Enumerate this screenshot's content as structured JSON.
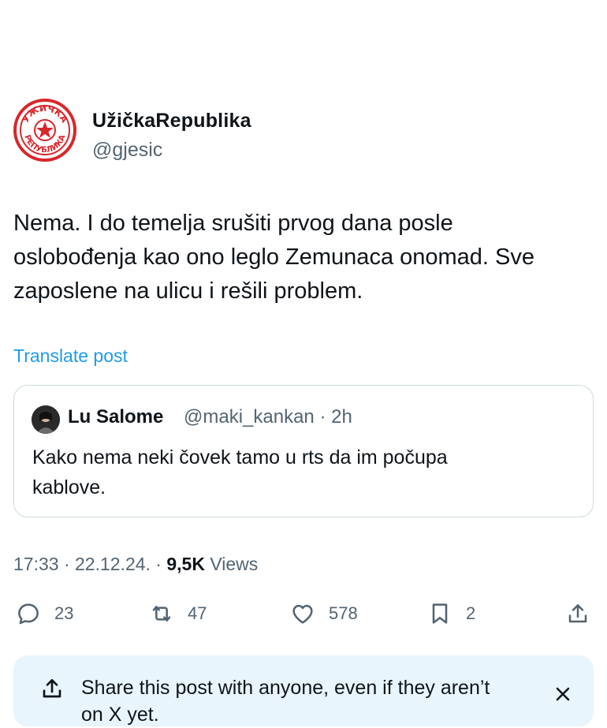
{
  "author": {
    "display_name": "UžičkaRepublika",
    "handle": "@gjesic",
    "avatar_text": "УЖИЧКА РЕПУБЛИКА",
    "avatar_color": "#d9262b"
  },
  "tweet": {
    "lines": [
      "Nema. I do temelja srušiti prvog dana posle",
      "oslobođenja kao ono leglo Zemunaca onomad. Sve",
      "zaposlene na ulicu i rešili problem."
    ],
    "translate_label": "Translate post"
  },
  "quoted": {
    "display_name": "Lu Salome",
    "handle_time": "@maki_kankan · 2h",
    "lines": [
      "Kako nema neki čovek tamo u rts da im počupa",
      "kablove."
    ]
  },
  "meta": {
    "time_date": "17:33 · 22.12.24. · ",
    "views_count": "9,5K",
    "views_label": " Views"
  },
  "actions": {
    "replies": "23",
    "reposts": "47",
    "likes": "578",
    "bookmarks": "2"
  },
  "share_banner": {
    "text_line1": "Share this post with anyone, even if they aren’t",
    "text_line2": "on X yet."
  },
  "colors": {
    "accent": "#1d9bf0",
    "secondary_text": "#536471",
    "banner_bg": "#e8f5fd"
  }
}
